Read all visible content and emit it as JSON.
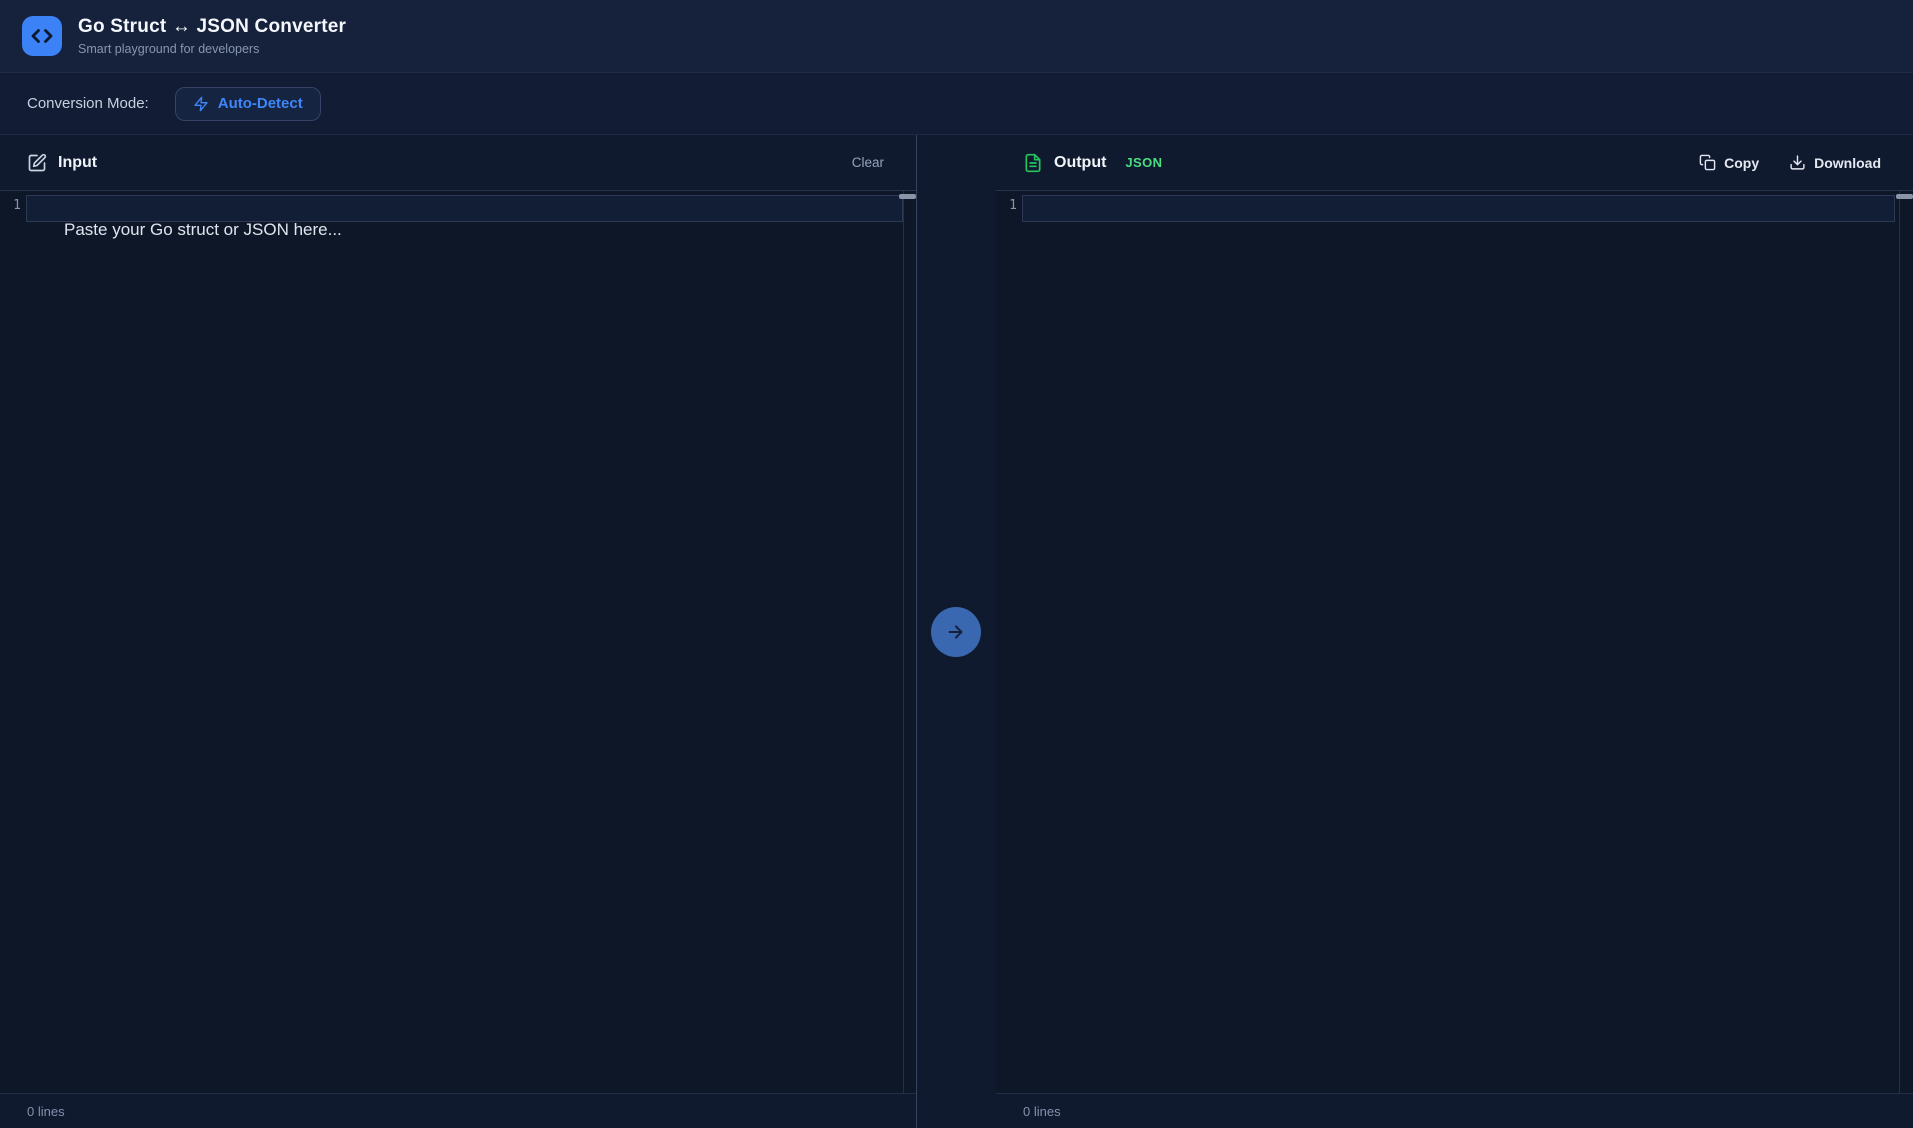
{
  "header": {
    "title": "Go Struct ↔ JSON Converter",
    "subtitle": "Smart playground for developers"
  },
  "mode_bar": {
    "label": "Conversion Mode:",
    "mode_button": "Auto-Detect"
  },
  "input_panel": {
    "title": "Input",
    "clear_label": "Clear",
    "line_number": "1",
    "placeholder": "Paste your Go struct or JSON here...",
    "status": "0 lines"
  },
  "output_panel": {
    "title": "Output",
    "format_badge": "JSON",
    "copy_label": "Copy",
    "download_label": "Download",
    "line_number": "1",
    "status": "0 lines"
  },
  "colors": {
    "accent_blue": "#3b82f6",
    "accent_green": "#22c55e",
    "convert_button": "#3a68b0"
  }
}
